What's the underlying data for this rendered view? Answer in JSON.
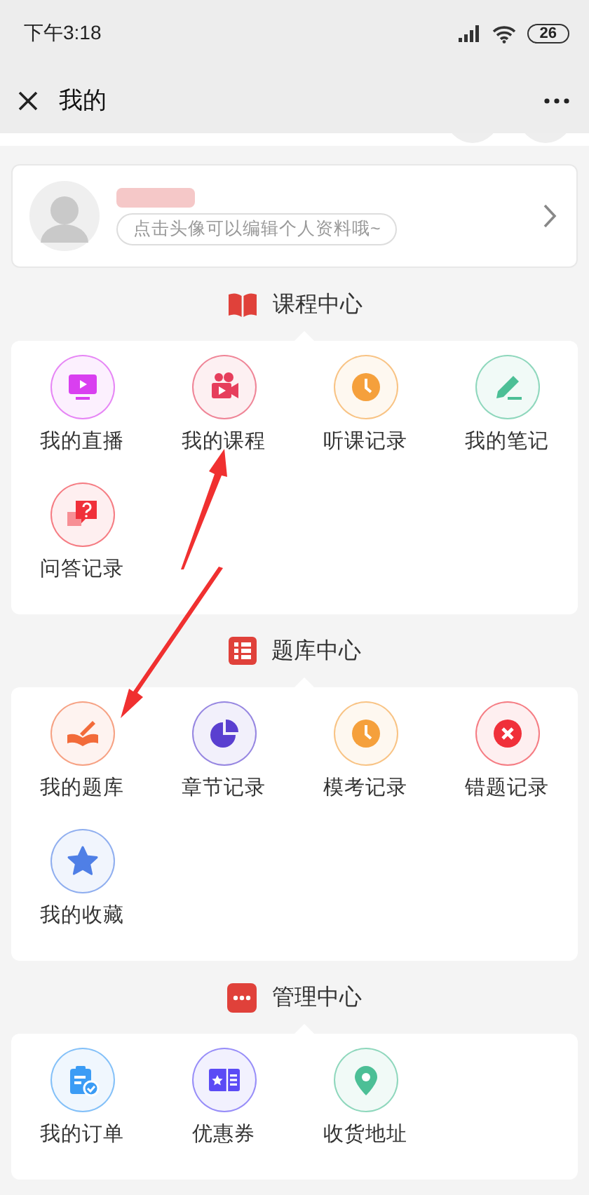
{
  "status_bar": {
    "time": "下午3:18",
    "battery": "26"
  },
  "nav": {
    "title": "我的"
  },
  "profile": {
    "hint": "点击头像可以编辑个人资料哦~"
  },
  "sections": [
    {
      "title": "课程中心",
      "items": [
        {
          "label": "我的直播",
          "color": "#d93ff0"
        },
        {
          "label": "我的课程",
          "color": "#e63e5c"
        },
        {
          "label": "听课记录",
          "color": "#f5a03c"
        },
        {
          "label": "我的笔记",
          "color": "#4cbf96"
        },
        {
          "label": "问答记录",
          "color": "#f0303a"
        }
      ]
    },
    {
      "title": "题库中心",
      "items": [
        {
          "label": "我的题库",
          "color": "#f26b3a"
        },
        {
          "label": "章节记录",
          "color": "#5a3fd0"
        },
        {
          "label": "模考记录",
          "color": "#f5a03c"
        },
        {
          "label": "错题记录",
          "color": "#f0303a"
        },
        {
          "label": "我的收藏",
          "color": "#4f7fe6"
        }
      ]
    },
    {
      "title": "管理中心",
      "items": [
        {
          "label": "我的订单",
          "color": "#3b9cf5"
        },
        {
          "label": "优惠券",
          "color": "#5b4bf5"
        },
        {
          "label": "收货地址",
          "color": "#4cbf96"
        }
      ]
    }
  ]
}
